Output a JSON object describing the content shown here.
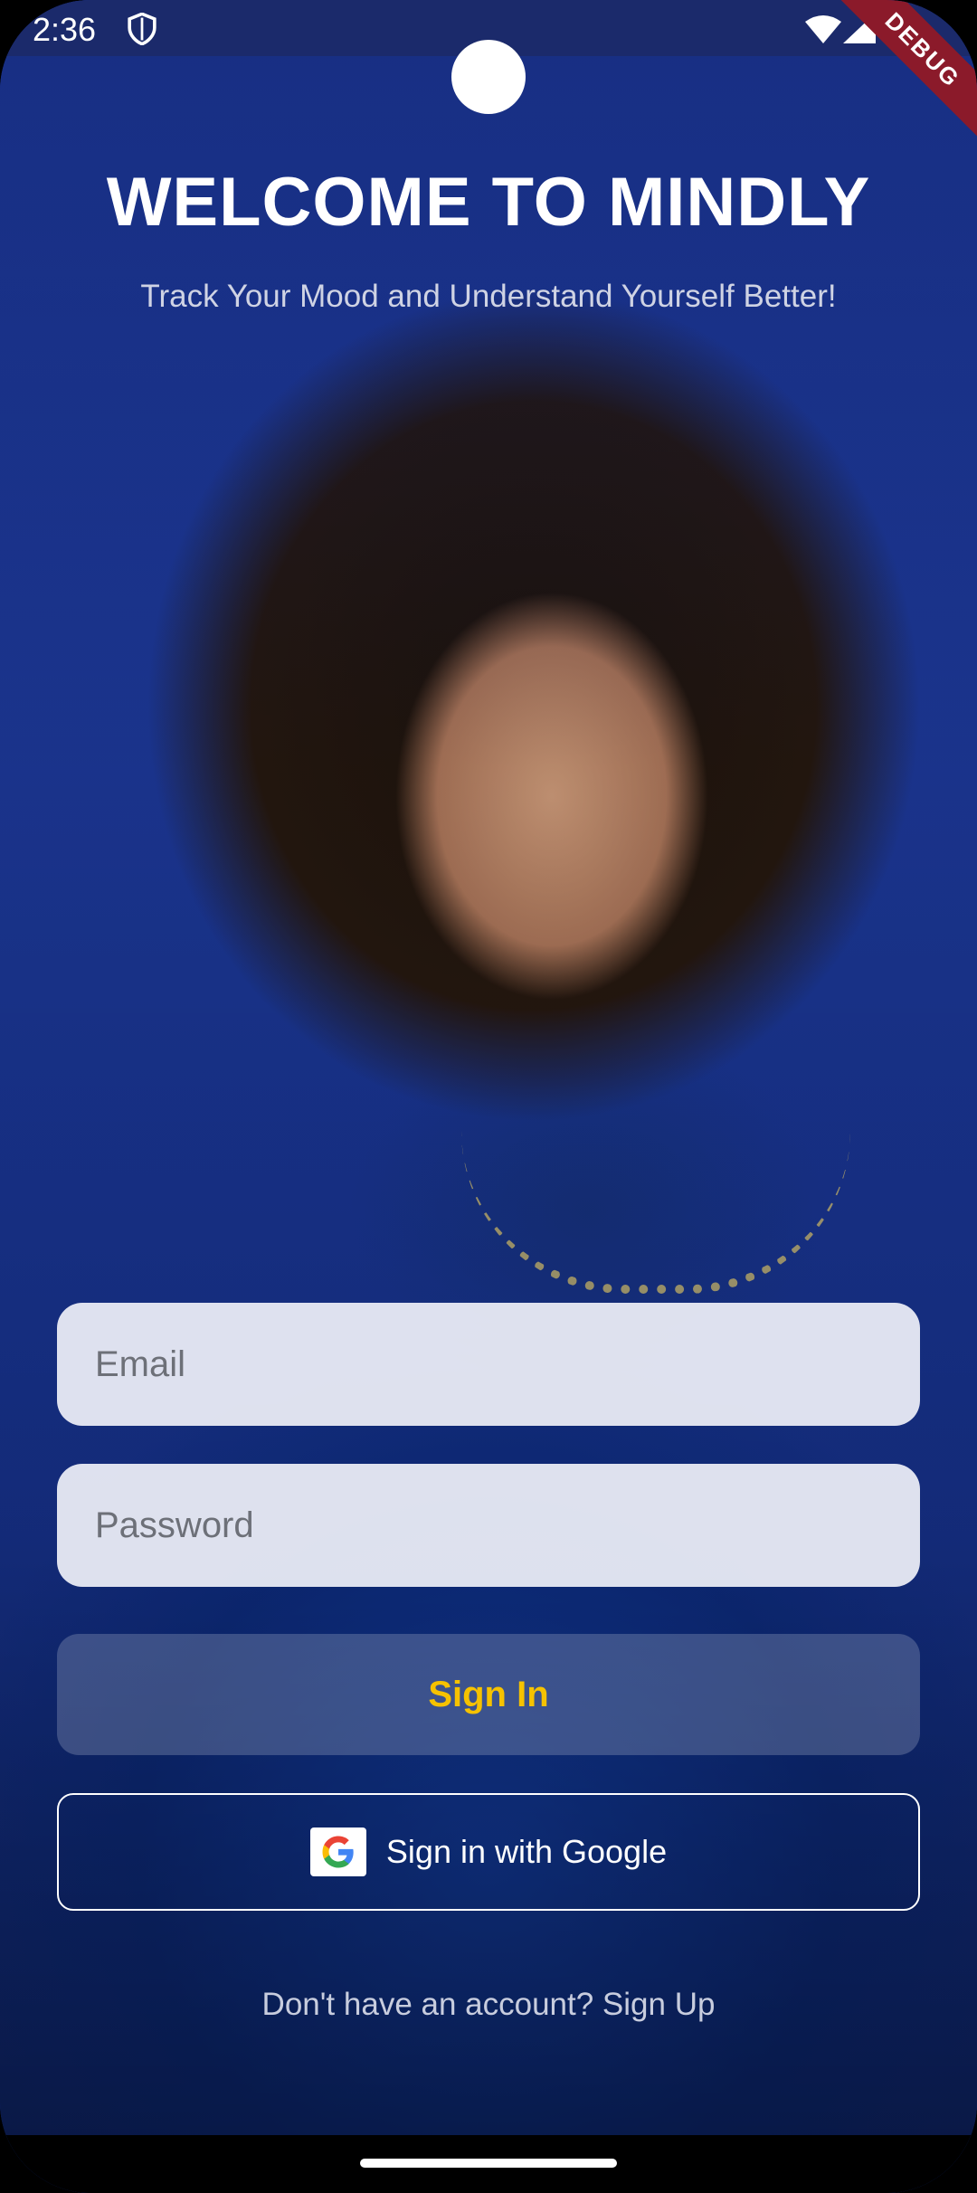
{
  "status_bar": {
    "time": "2:36",
    "icons": [
      "shield-icon",
      "wifi-icon",
      "signal-icon",
      "battery-icon"
    ]
  },
  "debug_banner": "DEBUG",
  "header": {
    "title": "WELCOME TO MINDLY",
    "subtitle": "Track Your Mood and Understand Yourself Better!"
  },
  "form": {
    "email_placeholder": "Email",
    "password_placeholder": "Password",
    "sign_in_label": "Sign In",
    "google_label": "Sign in with Google"
  },
  "footer": {
    "signup_text": "Don't have an account? Sign Up"
  },
  "colors": {
    "accent": "#f6c200",
    "background": "#1c3794",
    "debug": "#8b1a2a"
  }
}
